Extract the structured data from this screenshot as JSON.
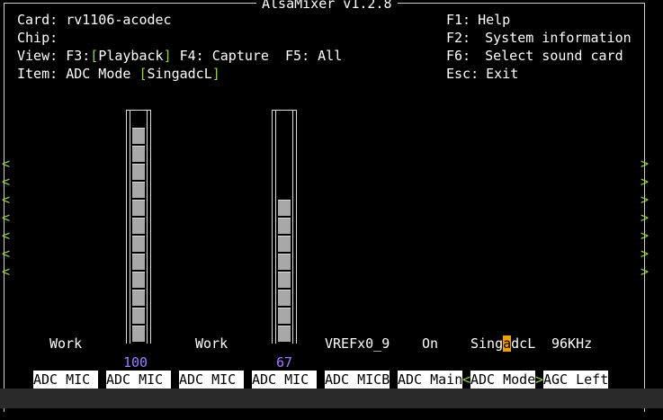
{
  "title": "AlsaMixer v1.2.8",
  "info": {
    "card_label": "Card:",
    "card_value": "rv1106-acodec",
    "chip_label": "Chip:",
    "chip_value": "",
    "view_label": "View:",
    "view_f3": "F3:",
    "view_playback": "Playback",
    "view_f4": "F4:",
    "view_capture": "Capture",
    "view_f5": "F5:",
    "view_all": "All",
    "item_label": "Item:",
    "item_value": "ADC Mode",
    "item_state": "SingadcL"
  },
  "help": [
    {
      "key": "F1:",
      "text": "Help"
    },
    {
      "key": "F2:",
      "text": "System information"
    },
    {
      "key": "F6:",
      "text": "Select sound card"
    },
    {
      "key": "Esc:",
      "text": "Exit"
    }
  ],
  "arrows": {
    "left": "<",
    "right": ">"
  },
  "controls": [
    {
      "value_text": "Work",
      "number": "",
      "tab": "ADC MIC"
    },
    {
      "value_text": "",
      "number": "100",
      "tab": "ADC MIC",
      "level": 1.0
    },
    {
      "value_text": "Work",
      "number": "",
      "tab": "ADC MIC"
    },
    {
      "value_text": "",
      "number": "67",
      "tab": "ADC MIC",
      "level": 0.67
    },
    {
      "value_text": "VREFx0_9",
      "number": "",
      "tab": "ADC MICB"
    },
    {
      "value_text": "On",
      "number": "",
      "tab": "ADC Main"
    },
    {
      "value_text_pre": "Sing",
      "value_text_cursor": "a",
      "value_text_post": "dcL",
      "number": "",
      "tab": "ADC Mode",
      "selected": true
    },
    {
      "value_text": "96KHz",
      "number": "",
      "tab": "AGC Left"
    }
  ],
  "colors": {
    "accent_green": "#9ad14a",
    "number_purple": "#9c7cff",
    "cursor_orange": "#f0a000"
  }
}
